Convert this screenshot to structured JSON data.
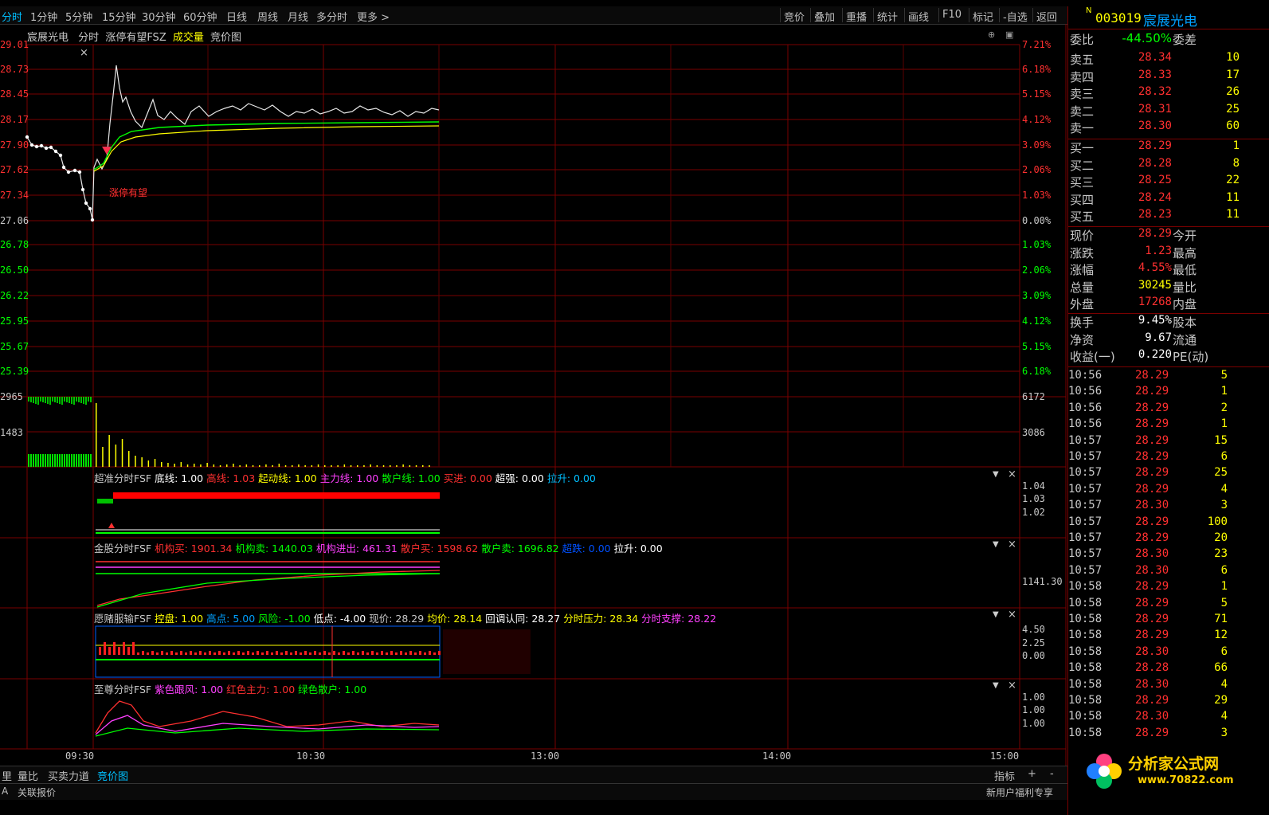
{
  "toolbar": {
    "periods": [
      "分时",
      "1分钟",
      "5分钟",
      "15分钟",
      "30分钟",
      "60分钟",
      "日线",
      "周线",
      "月线",
      "多分时",
      "更多 >"
    ],
    "right": [
      "竞价",
      "叠加",
      "重播",
      "统计",
      "画线",
      "F10",
      "标记",
      "-自选",
      "返回"
    ]
  },
  "chart_header": {
    "name": "宸展光电",
    "mode": "分时",
    "indicator": "涨停有望FSZ",
    "vol_label": "成交量",
    "auction_label": "竞价图"
  },
  "price_axis": {
    "left": [
      "29.01",
      "28.73",
      "28.45",
      "28.17",
      "27.90",
      "27.62",
      "27.34",
      "27.06",
      "26.78",
      "26.50",
      "26.22",
      "25.95",
      "25.67",
      "25.39"
    ],
    "right": [
      "7.21%",
      "6.18%",
      "5.15%",
      "4.12%",
      "3.09%",
      "2.06%",
      "1.03%",
      "0.00%",
      "1.03%",
      "2.06%",
      "3.09%",
      "4.12%",
      "5.15%",
      "6.18%"
    ]
  },
  "chart_annotation": "涨停有望",
  "volume_axis": {
    "left": [
      "2965",
      "1483"
    ],
    "right": [
      "6172",
      "3086"
    ]
  },
  "time_axis": [
    "09:30",
    "10:30",
    "13:00",
    "14:00",
    "15:00"
  ],
  "panel1": {
    "items": [
      {
        "t": "超准分时FSF",
        "c": "#c8c8c8"
      },
      {
        "t": "底线: 1.00",
        "c": "#ffffff"
      },
      {
        "t": "高线: 1.03",
        "c": "#ff3030"
      },
      {
        "t": "起动线: 1.00",
        "c": "#ffff00"
      },
      {
        "t": "主力线: 1.00",
        "c": "#ff40ff"
      },
      {
        "t": "散户线: 1.00",
        "c": "#00ff00"
      },
      {
        "t": "买进: 0.00",
        "c": "#ff3030"
      },
      {
        "t": "超强: 0.00",
        "c": "#ffffff"
      },
      {
        "t": "拉升: 0.00",
        "c": "#00c0ff"
      }
    ],
    "axis": [
      "1.04",
      "1.03",
      "1.02"
    ]
  },
  "panel2": {
    "items": [
      {
        "t": "金股分时FSF",
        "c": "#c8c8c8"
      },
      {
        "t": "机构买: 1901.34",
        "c": "#ff3030"
      },
      {
        "t": "机构卖: 1440.03",
        "c": "#00ff00"
      },
      {
        "t": "机构进出: 461.31",
        "c": "#ff40ff"
      },
      {
        "t": "散户买: 1598.62",
        "c": "#ff3030"
      },
      {
        "t": "散户卖: 1696.82",
        "c": "#00ff00"
      },
      {
        "t": "超跌: 0.00",
        "c": "#0050ff"
      },
      {
        "t": "拉升: 0.00",
        "c": "#ffffff"
      }
    ],
    "axis": [
      "1141.30"
    ]
  },
  "panel3": {
    "items": [
      {
        "t": "愿赌服输FSF",
        "c": "#c8c8c8"
      },
      {
        "t": "控盘: 1.00",
        "c": "#ffff00"
      },
      {
        "t": "高点: 5.00",
        "c": "#00a0ff"
      },
      {
        "t": "风险: -1.00",
        "c": "#00ff00"
      },
      {
        "t": "低点: -4.00",
        "c": "#ffffff"
      },
      {
        "t": "现价: 28.29",
        "c": "#c8c8c8"
      },
      {
        "t": "均价: 28.14",
        "c": "#ffff00"
      },
      {
        "t": "回调认同: 28.27",
        "c": "#ffffff"
      },
      {
        "t": "分时压力: 28.34",
        "c": "#ffff00"
      },
      {
        "t": "分时支撑: 28.22",
        "c": "#ff40ff"
      }
    ],
    "axis": [
      "4.50",
      "2.25",
      "0.00"
    ]
  },
  "panel4": {
    "items": [
      {
        "t": "至尊分时FSF",
        "c": "#c8c8c8"
      },
      {
        "t": "紫色跟风: 1.00",
        "c": "#ff40ff"
      },
      {
        "t": "红色主力: 1.00",
        "c": "#ff3030"
      },
      {
        "t": "绿色散户: 1.00",
        "c": "#00ff00"
      }
    ],
    "axis": [
      "1.00",
      "1.00",
      "1.00"
    ]
  },
  "bottom_tabs": [
    "里",
    "量比",
    "买卖力道",
    "竞价图"
  ],
  "bottom_right": [
    "指标",
    "+",
    "-"
  ],
  "status": {
    "left": [
      "A",
      "关联报价"
    ],
    "right": "新用户福利专享"
  },
  "stock": {
    "code": "003019",
    "name": "宸展光电"
  },
  "webi": {
    "label": "委比",
    "value": "-44.50%",
    "label2": "委差"
  },
  "sell": [
    {
      "label": "卖五",
      "price": "28.34",
      "vol": "10"
    },
    {
      "label": "卖四",
      "price": "28.33",
      "vol": "17"
    },
    {
      "label": "卖三",
      "price": "28.32",
      "vol": "26"
    },
    {
      "label": "卖二",
      "price": "28.31",
      "vol": "25"
    },
    {
      "label": "卖一",
      "price": "28.30",
      "vol": "60"
    }
  ],
  "buy": [
    {
      "label": "买一",
      "price": "28.29",
      "vol": "1"
    },
    {
      "label": "买二",
      "price": "28.28",
      "vol": "8"
    },
    {
      "label": "买三",
      "price": "28.25",
      "vol": "22"
    },
    {
      "label": "买四",
      "price": "28.24",
      "vol": "11"
    },
    {
      "label": "买五",
      "price": "28.23",
      "vol": "11"
    }
  ],
  "quote": [
    {
      "l": "现价",
      "v": "28.29",
      "c": "#ff3030",
      "l2": "今开"
    },
    {
      "l": "涨跌",
      "v": "1.23",
      "c": "#ff3030",
      "l2": "最高"
    },
    {
      "l": "涨幅",
      "v": "4.55%",
      "c": "#ff3030",
      "l2": "最低"
    },
    {
      "l": "总量",
      "v": "30245",
      "c": "#ffff00",
      "l2": "量比"
    },
    {
      "l": "外盘",
      "v": "17268",
      "c": "#ff3030",
      "l2": "内盘"
    },
    {
      "l": "换手",
      "v": "9.45%",
      "c": "#ffffff",
      "l2": "股本"
    },
    {
      "l": "净资",
      "v": "9.67",
      "c": "#ffffff",
      "l2": "流通"
    },
    {
      "l": "收益(一)",
      "v": "0.220",
      "c": "#ffffff",
      "l2": "PE(动)"
    }
  ],
  "ticks": [
    {
      "t": "10:56",
      "p": "28.29",
      "v": "5"
    },
    {
      "t": "10:56",
      "p": "28.29",
      "v": "1"
    },
    {
      "t": "10:56",
      "p": "28.29",
      "v": "2"
    },
    {
      "t": "10:56",
      "p": "28.29",
      "v": "1"
    },
    {
      "t": "10:57",
      "p": "28.29",
      "v": "15"
    },
    {
      "t": "10:57",
      "p": "28.29",
      "v": "6"
    },
    {
      "t": "10:57",
      "p": "28.29",
      "v": "25"
    },
    {
      "t": "10:57",
      "p": "28.29",
      "v": "4"
    },
    {
      "t": "10:57",
      "p": "28.30",
      "v": "3"
    },
    {
      "t": "10:57",
      "p": "28.29",
      "v": "100"
    },
    {
      "t": "10:57",
      "p": "28.29",
      "v": "20"
    },
    {
      "t": "10:57",
      "p": "28.30",
      "v": "23"
    },
    {
      "t": "10:57",
      "p": "28.30",
      "v": "6"
    },
    {
      "t": "10:58",
      "p": "28.29",
      "v": "1"
    },
    {
      "t": "10:58",
      "p": "28.29",
      "v": "5"
    },
    {
      "t": "10:58",
      "p": "28.29",
      "v": "71"
    },
    {
      "t": "10:58",
      "p": "28.29",
      "v": "12"
    },
    {
      "t": "10:58",
      "p": "28.30",
      "v": "6"
    },
    {
      "t": "10:58",
      "p": "28.28",
      "v": "66"
    },
    {
      "t": "10:58",
      "p": "28.30",
      "v": "4"
    },
    {
      "t": "10:58",
      "p": "28.29",
      "v": "29"
    },
    {
      "t": "10:58",
      "p": "28.30",
      "v": "4"
    },
    {
      "t": "10:58",
      "p": "28.29",
      "v": "3"
    }
  ],
  "logo": {
    "text": "分析家公式网",
    "url": "www.70822.com"
  }
}
